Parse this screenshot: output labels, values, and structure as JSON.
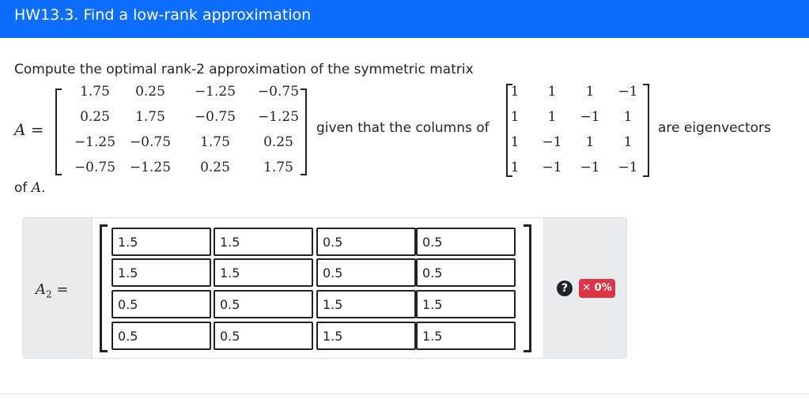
{
  "header": {
    "title": "HW13.3. Find a low-rank approximation"
  },
  "question": {
    "prompt_text": "Compute the optimal rank-2 approximation of the symmetric matrix",
    "matrix_label": "A =",
    "matrix_A": [
      [
        "1.75",
        "0.25",
        "−1.25",
        "−0.75"
      ],
      [
        "0.25",
        "1.75",
        "−0.75",
        "−1.25"
      ],
      [
        "−1.25",
        "−0.75",
        "1.75",
        "0.25"
      ],
      [
        "−0.75",
        "−1.25",
        "0.25",
        "1.75"
      ]
    ],
    "given_text": "given that the columns of",
    "eigenvector_matrix": [
      [
        "1",
        "1",
        "1",
        "−1"
      ],
      [
        "1",
        "1",
        "−1",
        "1"
      ],
      [
        "1",
        "−1",
        "1",
        "1"
      ],
      [
        "1",
        "−1",
        "−1",
        "−1"
      ]
    ],
    "eigen_text": "are eigenvectors",
    "of_prefix": "of",
    "of_var": "A",
    "of_suffix": "."
  },
  "answer": {
    "label_var": "A",
    "label_sub": "2",
    "label_eq": "=",
    "inputs": [
      [
        "1.5",
        "1.5",
        "0.5",
        "0.5"
      ],
      [
        "1.5",
        "1.5",
        "0.5",
        "0.5"
      ],
      [
        "0.5",
        "0.5",
        "1.5",
        "1.5"
      ],
      [
        "0.5",
        "0.5",
        "1.5",
        "1.5"
      ]
    ],
    "help_icon": "question-circle-icon",
    "help_glyph": "?",
    "score_badge": "✕ 0%",
    "score_color": "#dc3545"
  },
  "colors": {
    "header_bg": "#0d6efd",
    "panel_bg": "#e9ecef"
  }
}
